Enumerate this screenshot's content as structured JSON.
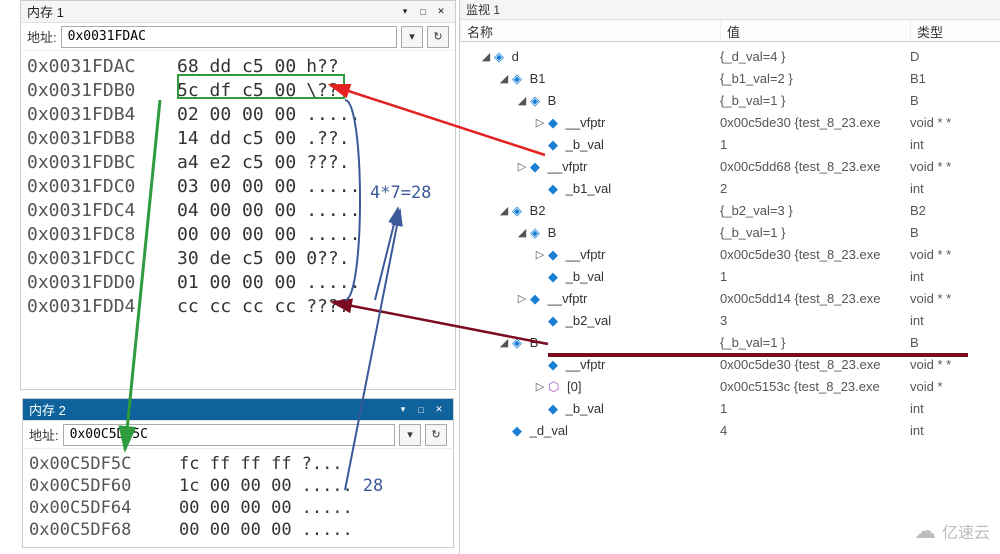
{
  "mem1": {
    "title": "内存 1",
    "addr_label": "地址:",
    "addr_value": "0x0031FDAC",
    "rows": [
      {
        "addr": "0x0031FDAC",
        "hex": "68 dd c5 00",
        "asc": "h??"
      },
      {
        "addr": "0x0031FDB0",
        "hex": "5c df c5 00",
        "asc": "\\??."
      },
      {
        "addr": "0x0031FDB4",
        "hex": "02 00 00 00",
        "asc": "....."
      },
      {
        "addr": "0x0031FDB8",
        "hex": "14 dd c5 00",
        "asc": ".??."
      },
      {
        "addr": "0x0031FDBC",
        "hex": "a4 e2 c5 00",
        "asc": "???."
      },
      {
        "addr": "0x0031FDC0",
        "hex": "03 00 00 00",
        "asc": "....."
      },
      {
        "addr": "0x0031FDC4",
        "hex": "04 00 00 00",
        "asc": "....."
      },
      {
        "addr": "0x0031FDC8",
        "hex": "00 00 00 00",
        "asc": "....."
      },
      {
        "addr": "0x0031FDCC",
        "hex": "30 de c5 00",
        "asc": "0??."
      },
      {
        "addr": "0x0031FDD0",
        "hex": "01 00 00 00",
        "asc": "....."
      },
      {
        "addr": "0x0031FDD4",
        "hex": "cc cc cc cc",
        "asc": "????"
      }
    ]
  },
  "mem2": {
    "title": "内存 2",
    "addr_label": "地址:",
    "addr_value": "0x00C5DF5C",
    "rows": [
      {
        "addr": "0x00C5DF5C",
        "hex": "fc ff ff ff",
        "asc": "?...",
        "extra": ""
      },
      {
        "addr": "0x00C5DF60",
        "hex": "1c 00 00 00",
        "asc": ".....",
        "extra": "28"
      },
      {
        "addr": "0x00C5DF64",
        "hex": "00 00 00 00",
        "asc": ".....",
        "extra": ""
      },
      {
        "addr": "0x00C5DF68",
        "hex": "00 00 00 00",
        "asc": ".....",
        "extra": ""
      }
    ]
  },
  "formula": "4*7=28",
  "watch": {
    "panel_title": "监视 1",
    "headers": {
      "name": "名称",
      "value": "值",
      "type": "类型"
    },
    "rows": [
      {
        "lvl": 0,
        "tw": "◢",
        "ico": "cube",
        "name": "d",
        "val": "{_d_val=4 }",
        "typ": "D"
      },
      {
        "lvl": 1,
        "tw": "◢",
        "ico": "cube",
        "name": "B1",
        "val": "{_b1_val=2 }",
        "typ": "B1"
      },
      {
        "lvl": 2,
        "tw": "◢",
        "ico": "cube",
        "name": "B",
        "val": "{_b_val=1 }",
        "typ": "B"
      },
      {
        "lvl": 3,
        "tw": "▷",
        "ico": "field",
        "name": "__vfptr",
        "val": "0x00c5de30 {test_8_23.exe",
        "typ": "void * *"
      },
      {
        "lvl": 3,
        "tw": "",
        "ico": "field",
        "name": "_b_val",
        "val": "1",
        "typ": "int"
      },
      {
        "lvl": 2,
        "tw": "▷",
        "ico": "field",
        "name": "__vfptr",
        "val": "0x00c5dd68 {test_8_23.exe",
        "typ": "void * *"
      },
      {
        "lvl": 3,
        "tw": "",
        "ico": "field",
        "name": "_b1_val",
        "val": "2",
        "typ": "int"
      },
      {
        "lvl": 1,
        "tw": "◢",
        "ico": "cube",
        "name": "B2",
        "val": "{_b2_val=3 }",
        "typ": "B2"
      },
      {
        "lvl": 2,
        "tw": "◢",
        "ico": "cube",
        "name": "B",
        "val": "{_b_val=1 }",
        "typ": "B"
      },
      {
        "lvl": 3,
        "tw": "▷",
        "ico": "field",
        "name": "__vfptr",
        "val": "0x00c5de30 {test_8_23.exe",
        "typ": "void * *"
      },
      {
        "lvl": 3,
        "tw": "",
        "ico": "field",
        "name": "_b_val",
        "val": "1",
        "typ": "int"
      },
      {
        "lvl": 2,
        "tw": "▷",
        "ico": "field",
        "name": "__vfptr",
        "val": "0x00c5dd14 {test_8_23.exe",
        "typ": "void * *"
      },
      {
        "lvl": 3,
        "tw": "",
        "ico": "field",
        "name": "_b2_val",
        "val": "3",
        "typ": "int"
      },
      {
        "lvl": 1,
        "tw": "◢",
        "ico": "cube",
        "name": "B",
        "val": "{_b_val=1 }",
        "typ": "B"
      },
      {
        "lvl": 3,
        "tw": "",
        "ico": "field",
        "name": "__vfptr",
        "val": "0x00c5de30 {test_8_23.exe",
        "typ": "void * *"
      },
      {
        "lvl": 3,
        "tw": "▷",
        "ico": "func",
        "name": "[0]",
        "val": "0x00c5153c {test_8_23.exe",
        "typ": "void *"
      },
      {
        "lvl": 3,
        "tw": "",
        "ico": "field",
        "name": "_b_val",
        "val": "1",
        "typ": "int"
      },
      {
        "lvl": 1,
        "tw": "",
        "ico": "field",
        "name": "_d_val",
        "val": "4",
        "typ": "int"
      }
    ]
  },
  "watermark": "亿速云"
}
